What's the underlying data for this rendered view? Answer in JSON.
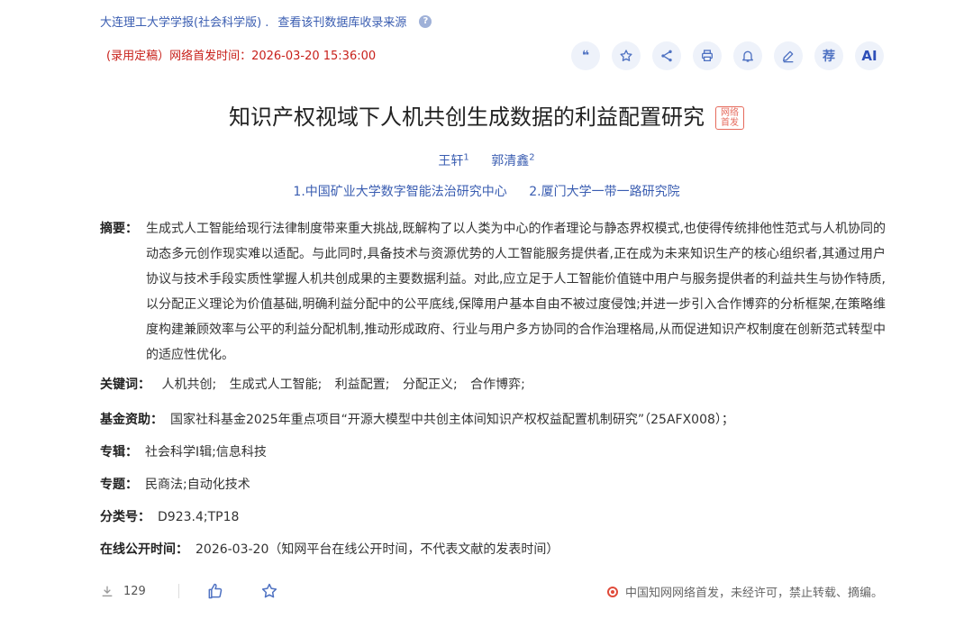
{
  "header": {
    "journal": "大连理工大学学报(社会科学版) .",
    "db_link": "查看该刊数据库收录来源",
    "help_icon": "?"
  },
  "status": "(录用定稿）网络首发时间：2026-03-20 15:36:00",
  "toolbar": {
    "quote": "quote-icon",
    "favorite": "star-icon",
    "share": "share-icon",
    "print": "print-icon",
    "notify": "bell-icon",
    "note": "pen-icon",
    "recommend_label": "荐",
    "ai_label": "AI"
  },
  "article": {
    "title": "知识产权视域下人机共创生成数据的利益配置研究",
    "badge": "网络首发",
    "authors": [
      {
        "name": "王轩",
        "sup": "1"
      },
      {
        "name": "郭清鑫",
        "sup": "2"
      }
    ],
    "orgs": [
      "1.中国矿业大学数字智能法治研究中心",
      "2.厦门大学一带一路研究院"
    ],
    "abstract_label": "摘要：",
    "abstract": "生成式人工智能给现行法律制度带来重大挑战,既解构了以人类为中心的作者理论与静态界权模式,也使得传统排他性范式与人机协同的动态多元创作现实难以适配。与此同时,具备技术与资源优势的人工智能服务提供者,正在成为未来知识生产的核心组织者,其通过用户协议与技术手段实质性掌握人机共创成果的主要数据利益。对此,应立足于人工智能价值链中用户与服务提供者的利益共生与协作特质,以分配正义理论为价值基础,明确利益分配中的公平底线,保障用户基本自由不被过度侵蚀;并进一步引入合作博弈的分析框架,在策略维度构建兼顾效率与公平的利益分配机制,推动形成政府、行业与用户多方协同的合作治理格局,从而促进知识产权制度在创新范式转型中的适应性优化。",
    "keywords_label": "关键词：",
    "keywords": [
      "人机共创;",
      "生成式人工智能;",
      "利益配置;",
      "分配正义;",
      "合作博弈;"
    ],
    "fund_label": "基金资助：",
    "fund": "国家社科基金2025年重点项目“开源大模型中共创主体间知识产权权益配置机制研究”（25AFX008）；",
    "series_label": "专辑：",
    "series": "社会科学Ⅰ辑;信息科技",
    "topic_label": "专题：",
    "topic": "民商法;自动化技术",
    "class_label": "分类号：",
    "class": "D923.4;TP18",
    "online_label": "在线公开时间：",
    "online": "2026-03-20（知网平台在线公开时间，不代表文献的发表时间）"
  },
  "footer": {
    "downloads": "129",
    "notice": "中国知网网络首发，未经许可，禁止转载、摘编。"
  }
}
